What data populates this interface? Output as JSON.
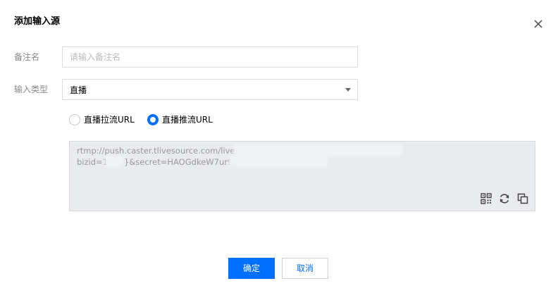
{
  "dialog": {
    "title": "添加输入源"
  },
  "form": {
    "remark_label": "备注名",
    "remark_placeholder": "请输入备注名",
    "remark_value": "",
    "type_label": "输入类型",
    "type_value": "直播"
  },
  "radios": [
    {
      "label": "直播拉流URL",
      "checked": false
    },
    {
      "label": "直播推流URL",
      "checked": true
    }
  ],
  "url_box": {
    "line1": "rtmp://push.caster.tlivesource.com/live/2",
    "line2_start": "bizid=1",
    "line2_rest": "}&secret=HAOGdkeW7ur9E"
  },
  "icons": {
    "close": "close-icon",
    "qr": "qrcode-icon",
    "refresh": "refresh-icon",
    "copy": "copy-icon"
  },
  "footer": {
    "ok_label": "确定",
    "cancel_label": "取消"
  },
  "colors": {
    "primary": "#006eff",
    "url_bg": "#e9ebef"
  }
}
